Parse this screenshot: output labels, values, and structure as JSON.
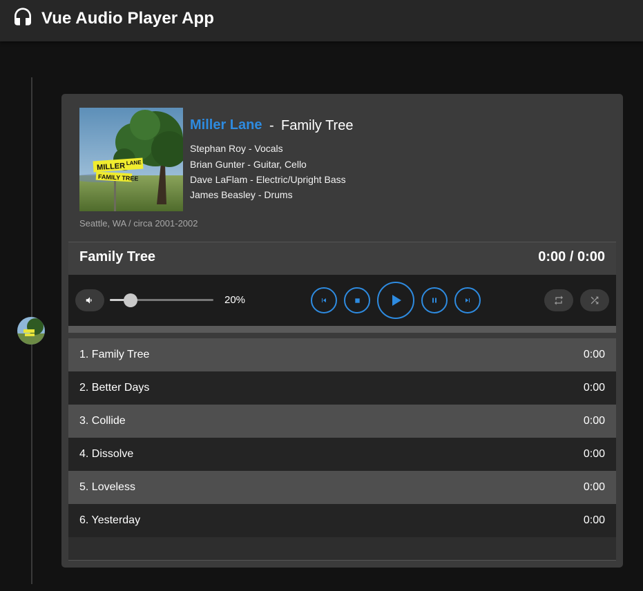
{
  "app": {
    "title": "Vue Audio Player App",
    "icon": "headphones-icon"
  },
  "album": {
    "band": "Miller Lane",
    "separator": "-",
    "title": "Family Tree",
    "members": [
      "Stephan Roy - Vocals",
      "Brian Gunter - Guitar, Cello",
      "Dave LaFlam - Electric/Upright Bass",
      "James Beasley - Drums"
    ],
    "location": "Seattle, WA / circa 2001-2002",
    "cover_sign_lines": [
      "MILLER LANE",
      "FAMILY TREE"
    ]
  },
  "player": {
    "now_playing": "Family Tree",
    "time": "0:00 / 0:00",
    "volume_label": "20%",
    "volume_level": 0.2,
    "accent_color": "#2e8be0"
  },
  "tracks": [
    {
      "title": "1. Family Tree",
      "duration": "0:00"
    },
    {
      "title": "2. Better Days",
      "duration": "0:00"
    },
    {
      "title": "3. Collide",
      "duration": "0:00"
    },
    {
      "title": "4. Dissolve",
      "duration": "0:00"
    },
    {
      "title": "5. Loveless",
      "duration": "0:00"
    },
    {
      "title": "6. Yesterday",
      "duration": "0:00"
    }
  ]
}
